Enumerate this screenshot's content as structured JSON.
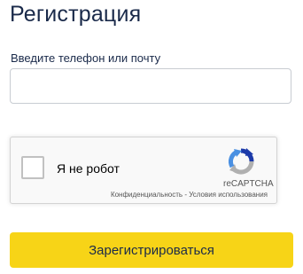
{
  "form": {
    "title": "Регистрация",
    "field_label": "Введите телефон или почту",
    "field_value": "",
    "field_placeholder": ""
  },
  "recaptcha": {
    "label": "Я не робот",
    "brand": "reCAPTCHA",
    "privacy_link": "Конфиденциальность",
    "separator": " - ",
    "terms_link": "Условия использования",
    "checked": false,
    "logo_icon": "recaptcha-logo-icon",
    "colors": {
      "logo_blue": "#1c3aa9",
      "logo_light_blue": "#4a90e2",
      "logo_gray": "#b0b0b0"
    }
  },
  "submit": {
    "label": "Зарегистрироваться"
  },
  "colors": {
    "accent": "#f7d417",
    "text": "#1a2a4a",
    "input_border": "#c8ccd2"
  }
}
